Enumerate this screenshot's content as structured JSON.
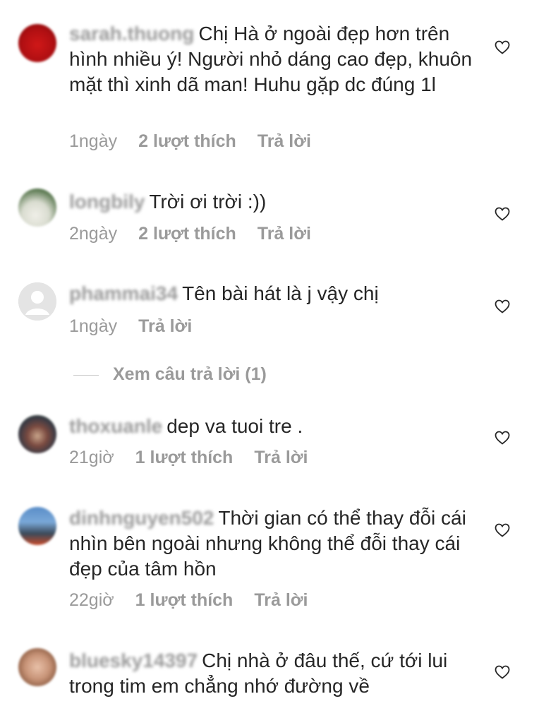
{
  "comments": [
    {
      "username": "sarah.thuong",
      "text": "Chị Hà ở ngoài đẹp hơn trên hình nhiều ý! Người nhỏ dáng cao đẹp, khuôn mặt thì xinh dã man! Huhu gặp dc đúng 1l",
      "time": "1ngày",
      "likes": "2 lượt thích",
      "reply": "Trả lời"
    },
    {
      "username": "longbily",
      "text": "Trời ơi trời :))",
      "time": "2ngày",
      "likes": "2 lượt thích",
      "reply": "Trả lời"
    },
    {
      "username": "phammai34",
      "text": "Tên bài hát là j vậy chị",
      "time": "1ngày",
      "reply": "Trả lời"
    },
    {
      "username": "thoxuanle",
      "text": "dep va tuoi tre .",
      "time": "21giờ",
      "likes": "1 lượt thích",
      "reply": "Trả lời"
    },
    {
      "username": "dinhnguyen502",
      "text": "Thời gian có thể thay đỗi cái nhìn bên ngoài nhưng không thể đỗi thay cái đẹp của tâm hồn",
      "time": "22giờ",
      "likes": "1 lượt thích",
      "reply": "Trả lời"
    },
    {
      "username": "bluesky14397",
      "text": "Chị nhà ở đâu thế, cứ tới lui trong tim em chẳng nhớ đường về"
    }
  ],
  "view_replies": "Xem câu trả lời (1)",
  "icons": {
    "like": "heart-outline-icon"
  },
  "colors": {
    "text": "#262626",
    "muted": "#9a9a9a"
  }
}
